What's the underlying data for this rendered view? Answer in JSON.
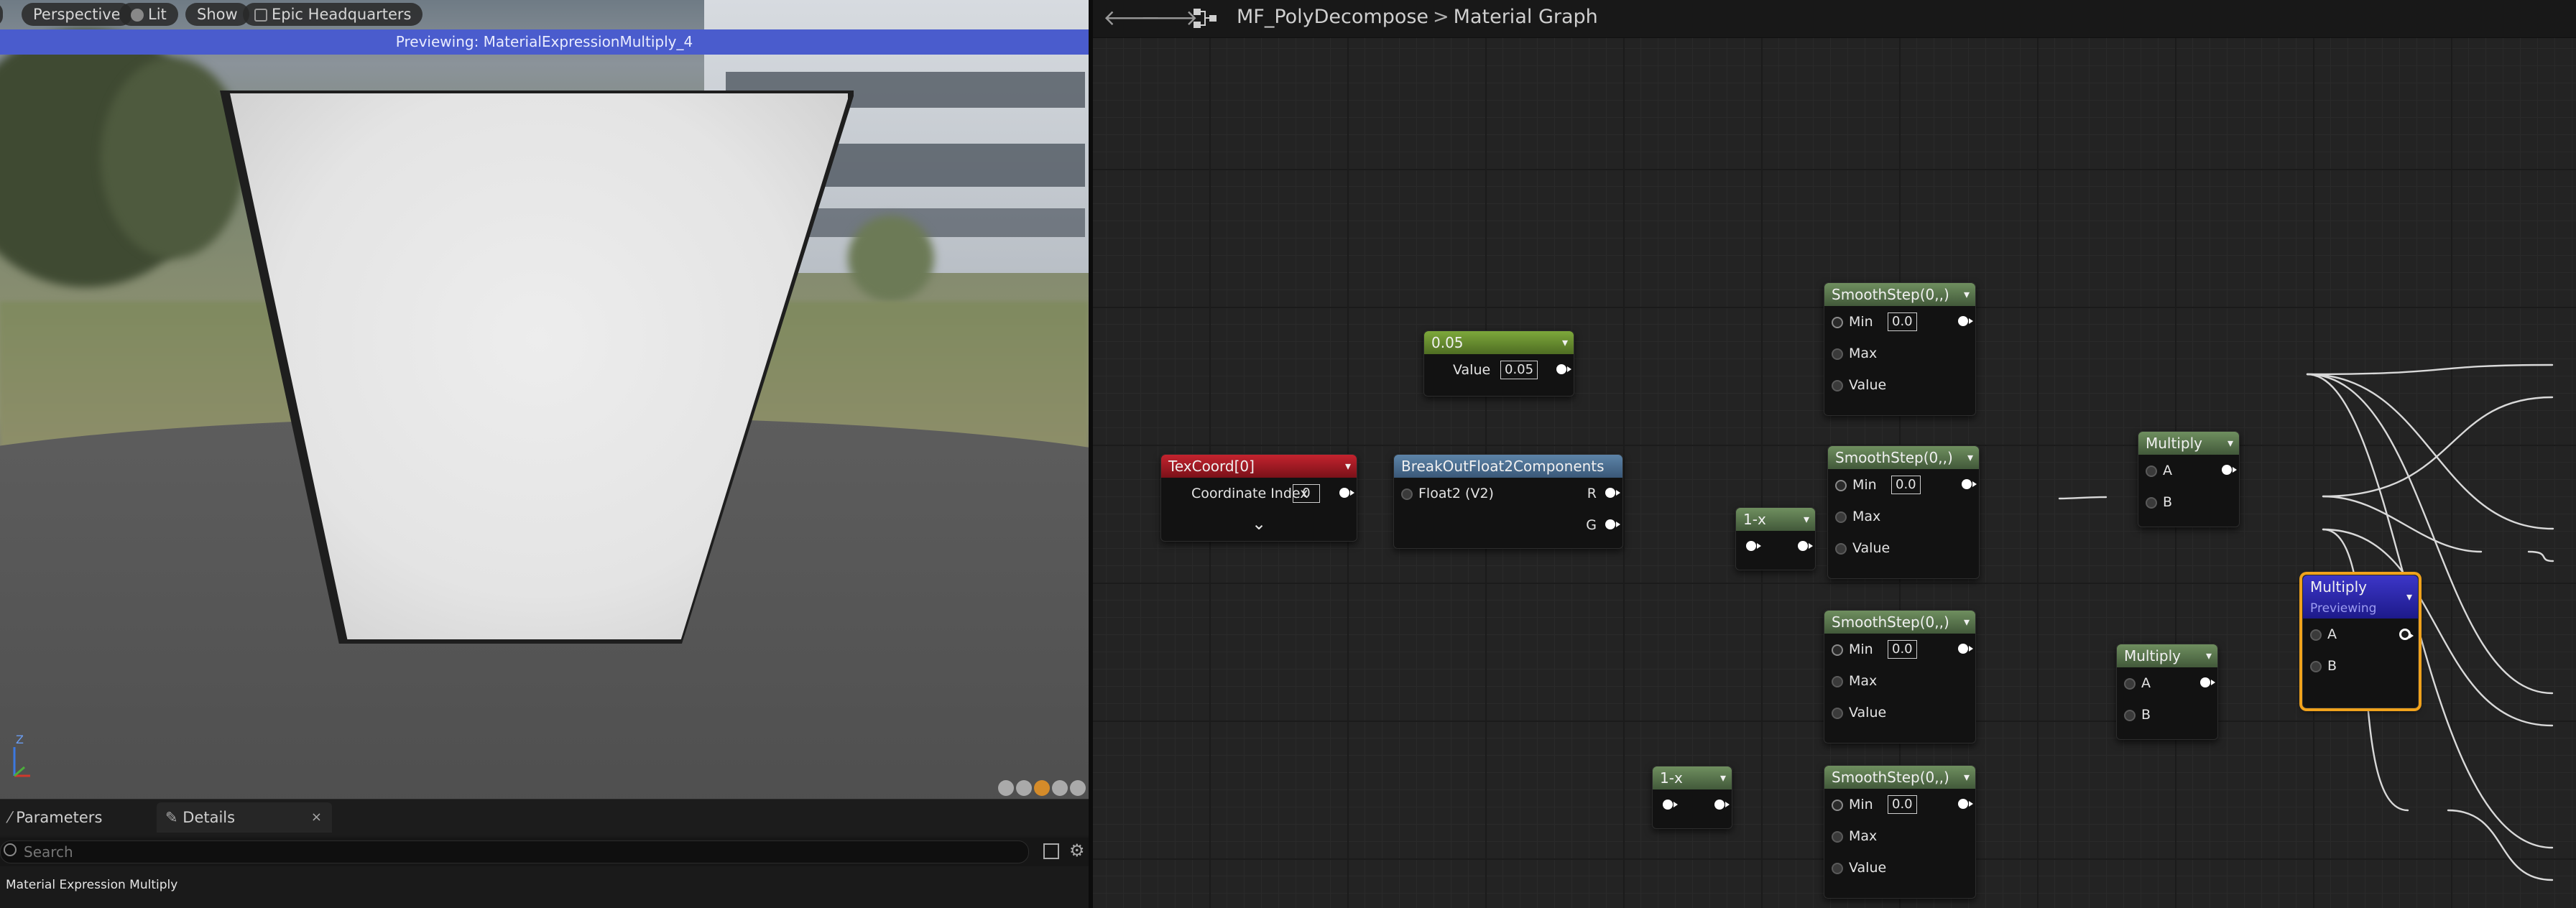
{
  "viewport": {
    "toolbar": {
      "perspective_label": "Perspective",
      "lit_label": "Lit",
      "show_label": "Show",
      "location_label": "Epic Headquarters"
    },
    "preview_banner": "Previewing: MaterialExpressionMultiply_4",
    "gizmo_axis_z": "Z"
  },
  "details_panel": {
    "tabs": [
      {
        "label": "Parameters"
      },
      {
        "label": "Details"
      }
    ],
    "close_glyph": "×",
    "search_placeholder": "Search",
    "title": "Material Expression Multiply"
  },
  "graph_header": {
    "back_glyph": "🡐",
    "forward_glyph": "🡒",
    "breadcrumb_asset": "MF_PolyDecompose",
    "breadcrumb_sep": ">",
    "breadcrumb_page": "Material Graph"
  },
  "nodes": {
    "const": {
      "title": "0.05",
      "value_label": "Value",
      "value": "0.05"
    },
    "texcoord": {
      "title": "TexCoord[0]",
      "index_label": "Coordinate Index",
      "index_value": "0",
      "expand_glyph": "⌄"
    },
    "breakout": {
      "title": "BreakOutFloat2Components",
      "input_label": "Float2 (V2)",
      "out_r": "R",
      "out_g": "G"
    },
    "oneminus1": {
      "title": "1-x"
    },
    "oneminus2": {
      "title": "1-x"
    },
    "ss1": {
      "title": "SmoothStep(0,,)",
      "min_label": "Min",
      "min_value": "0.0",
      "max_label": "Max",
      "value_label": "Value"
    },
    "ss2": {
      "title": "SmoothStep(0,,)",
      "min_label": "Min",
      "min_value": "0.0",
      "max_label": "Max",
      "value_label": "Value"
    },
    "ss3": {
      "title": "SmoothStep(0,,)",
      "min_label": "Min",
      "min_value": "0.0",
      "max_label": "Max",
      "value_label": "Value"
    },
    "ss4": {
      "title": "SmoothStep(0,,)",
      "min_label": "Min",
      "min_value": "0.0",
      "max_label": "Max",
      "value_label": "Value"
    },
    "mul1": {
      "title": "Multiply",
      "a_label": "A",
      "b_label": "B"
    },
    "mul2": {
      "title": "Multiply",
      "a_label": "A",
      "b_label": "B"
    },
    "mul3": {
      "title": "Multiply",
      "subtitle": "Previewing",
      "a_label": "A",
      "b_label": "B"
    }
  },
  "colors": {
    "preview_banner": "#4a5ccd",
    "selected_outline": "#f0a21c",
    "wire": "#d9d9d9"
  }
}
